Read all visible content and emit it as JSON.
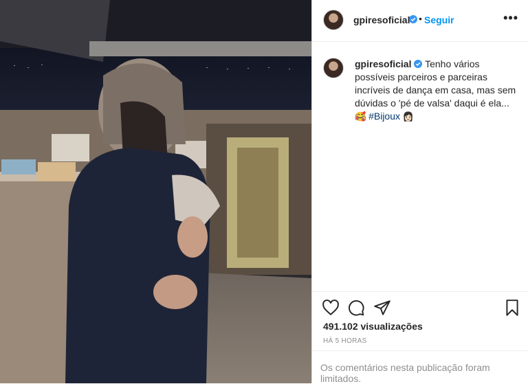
{
  "post": {
    "username": "gpiresoficial",
    "verified": true,
    "follow_label": "Seguir",
    "separator": "•",
    "more_label": "•••",
    "caption": {
      "text": "Tenho vários possíveis parceiros e parceiras incríveis de dança em casa, mas sem dúvidas o 'pé de valsa' daqui é ela... ",
      "emoji_1": "🥰",
      "hashtag": "#Bijoux",
      "emoji_2": "👩🏻",
      "time": "5 h"
    },
    "views_count": "491.102",
    "views_label": "visualizações",
    "timestamp": "HÁ 5 HORAS",
    "comments_limited": "Os comentários nesta publicação foram limitados."
  },
  "icons": {
    "like": "heart-icon",
    "comment": "comment-icon",
    "share": "send-icon",
    "save": "bookmark-icon",
    "verified": "verified-badge-icon"
  },
  "colors": {
    "accent": "#0095f6",
    "verified": "#3897f0",
    "muted": "#8e8e8e",
    "hashtag": "#00376b"
  }
}
